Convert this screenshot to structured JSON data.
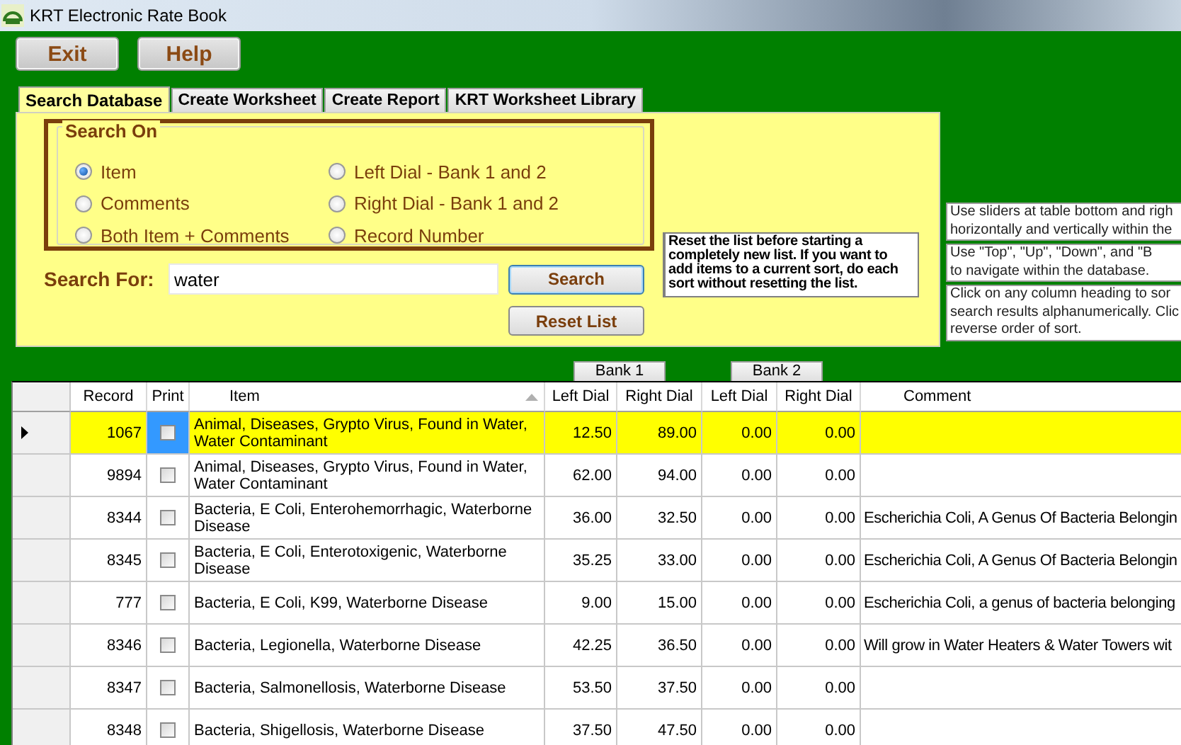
{
  "window": {
    "title": "KRT Electronic Rate Book"
  },
  "toolbar": {
    "buttons": [
      "Exit",
      "Help"
    ]
  },
  "tabs": [
    {
      "label": "Search Database",
      "selected": true
    },
    {
      "label": "Create Worksheet",
      "selected": false
    },
    {
      "label": "Create Report",
      "selected": false
    },
    {
      "label": "KRT Worksheet Library",
      "selected": false
    }
  ],
  "search_on": {
    "title": "Search On",
    "options": [
      {
        "label": "Item",
        "selected": true
      },
      {
        "label": "Comments",
        "selected": false
      },
      {
        "label": "Both Item + Comments",
        "selected": false
      },
      {
        "label": "Left Dial - Bank 1 and 2",
        "selected": false
      },
      {
        "label": "Right Dial - Bank 1 and 2",
        "selected": false
      },
      {
        "label": "Record Number",
        "selected": false
      }
    ]
  },
  "search_for": {
    "label": "Search For:",
    "value": "water"
  },
  "search_buttons": [
    "Search",
    "Reset List"
  ],
  "reset_note": "Reset the list before starting a completely new list.  If you want to add items to a current sort, do each sort without resetting the list.",
  "help_notes": [
    {
      "lines": [
        "Use sliders at table bottom and righ",
        "horizontally and vertically within the"
      ]
    },
    {
      "lines": [
        "Use \"Top\", \"Up\", \"Down\", and \"B",
        "to navigate within the database."
      ]
    },
    {
      "lines": [
        "Click on any column heading to sor",
        "search results alphanumerically. Clic",
        "reverse order of sort."
      ]
    }
  ],
  "banks": [
    "Bank 1",
    "Bank 2"
  ],
  "table": {
    "columns": [
      "Record",
      "Print",
      "Item",
      "Left Dial",
      "Right Dial",
      "Left Dial",
      "Right Dial",
      "Comment"
    ],
    "rows": [
      {
        "selected": true,
        "record": "1067",
        "print": false,
        "item": "Animal, Diseases, Grypto Virus, Found in Water, Water Contaminant",
        "values": [
          "12.50",
          "89.00",
          "0.00",
          "0.00"
        ]
      },
      {
        "selected": false,
        "record": "9894",
        "print": false,
        "item": "Animal, Diseases, Grypto Virus, Found in Water, Water Contaminant",
        "values": [
          "62.00",
          "94.00",
          "0.00",
          "0.00"
        ]
      },
      {
        "selected": false,
        "record": "8344",
        "print": false,
        "item": "Bacteria, E Coli, Enterohemorrhagic, Waterborne Disease",
        "values": [
          "36.00",
          "32.50",
          "0.00",
          "0.00"
        ],
        "comment": "Escherichia Coli, A Genus Of Bacteria Belongin"
      },
      {
        "selected": false,
        "record": "8345",
        "print": false,
        "item": "Bacteria, E Coli, Enterotoxigenic, Waterborne Disease",
        "values": [
          "35.25",
          "33.00",
          "0.00",
          "0.00"
        ],
        "comment": "Escherichia Coli, A Genus Of Bacteria Belongin"
      },
      {
        "selected": false,
        "record": "777",
        "print": false,
        "item": "Bacteria, E Coli, K99, Waterborne Disease",
        "values": [
          "9.00",
          "15.00",
          "0.00",
          "0.00"
        ],
        "comment": "Escherichia Coli, a genus of bacteria belonging"
      },
      {
        "selected": false,
        "record": "8346",
        "print": false,
        "item": "Bacteria, Legionella, Waterborne Disease",
        "values": [
          "42.25",
          "36.50",
          "0.00",
          "0.00"
        ],
        "comment": "Will grow in Water Heaters & Water Towers wit"
      },
      {
        "selected": false,
        "record": "8347",
        "print": false,
        "item": "Bacteria, Salmonellosis, Waterborne Disease",
        "values": [
          "53.50",
          "37.50",
          "0.00",
          "0.00"
        ]
      },
      {
        "selected": false,
        "record": "8348",
        "print": false,
        "item": "Bacteria, Shigellosis, Waterborne Disease",
        "values": [
          "37.50",
          "47.50",
          "0.00",
          "0.00"
        ]
      }
    ]
  }
}
